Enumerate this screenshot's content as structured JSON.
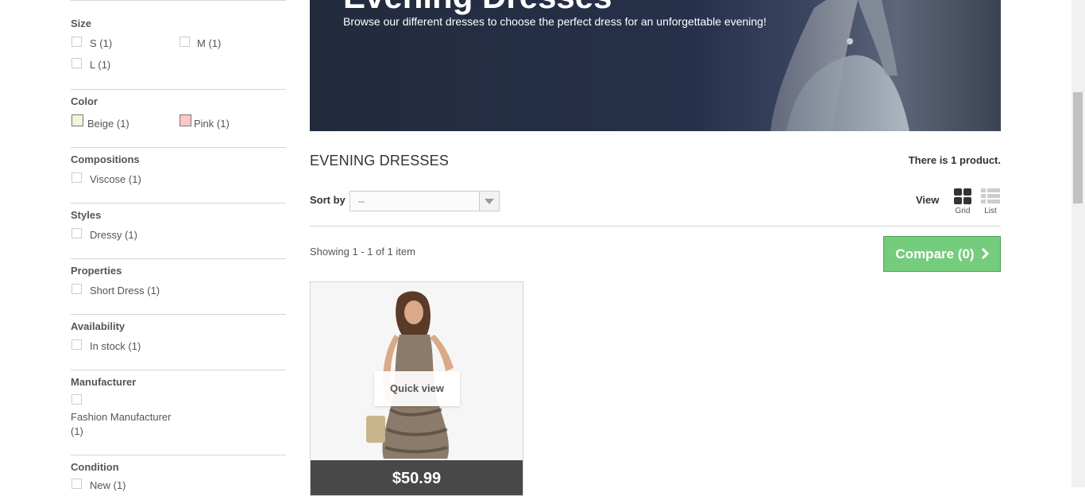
{
  "filters": {
    "size": {
      "title": "Size",
      "items": [
        "S (1)",
        "M (1)",
        "L (1)"
      ]
    },
    "color": {
      "title": "Color",
      "items": [
        {
          "label": "Beige (1)",
          "color": "#f5f5dc"
        },
        {
          "label": "Pink (1)",
          "color": "#fcc8c8"
        }
      ]
    },
    "compositions": {
      "title": "Compositions",
      "items": [
        "Viscose (1)"
      ]
    },
    "styles": {
      "title": "Styles",
      "items": [
        "Dressy (1)"
      ]
    },
    "properties": {
      "title": "Properties",
      "items": [
        "Short Dress (1)"
      ]
    },
    "availability": {
      "title": "Availability",
      "items": [
        "In stock (1)"
      ]
    },
    "manufacturer": {
      "title": "Manufacturer",
      "items": [
        "Fashion Manufacturer",
        "(1)"
      ]
    },
    "condition": {
      "title": "Condition",
      "items": [
        "New (1)"
      ]
    }
  },
  "banner": {
    "title": "Evening Dresses",
    "subtitle": "Browse our different dresses to choose the perfect dress for an unforgettable evening!"
  },
  "category": {
    "name": "EVENING DRESSES",
    "count_prefix": "There is ",
    "count_num": "1",
    "count_suffix": " product."
  },
  "sort": {
    "label": "Sort by",
    "value": "--"
  },
  "view": {
    "label": "View",
    "grid": "Grid",
    "list": "List"
  },
  "showing": "Showing 1 - 1 of 1 item",
  "compare": {
    "label": "Compare (0)",
    "color": "#76cc7d"
  },
  "product": {
    "quick_view": "Quick view",
    "price": "$50.99"
  }
}
